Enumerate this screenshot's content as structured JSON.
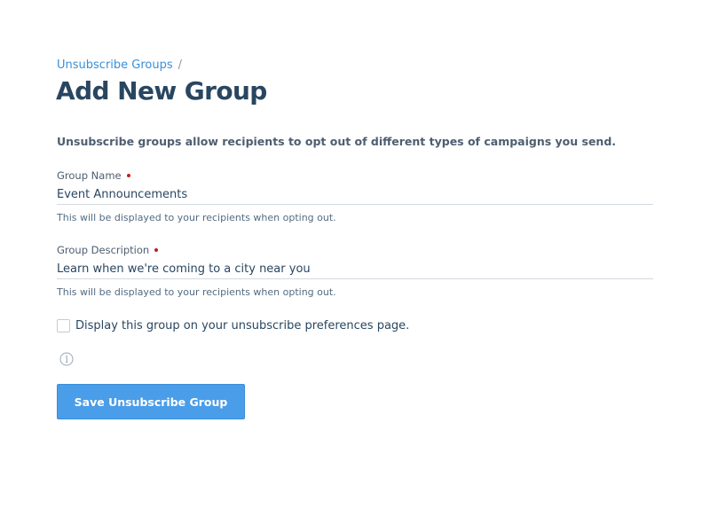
{
  "breadcrumb": {
    "link_label": "Unsubscribe Groups",
    "separator": "/"
  },
  "page": {
    "title": "Add New Group",
    "intro": "Unsubscribe groups allow recipients to opt out of different types of campaigns you send."
  },
  "form": {
    "group_name": {
      "label": "Group Name",
      "value": "Event Announcements",
      "help": "This will be displayed to your recipients when opting out.",
      "required": true
    },
    "group_description": {
      "label": "Group Description",
      "value": "Learn when we're coming to a city near you",
      "help": "This will be displayed to your recipients when opting out.",
      "required": true
    },
    "display_checkbox": {
      "label": "Display this group on your unsubscribe preferences page.",
      "checked": false
    },
    "info_icon": "info-icon",
    "save_label": "Save Unsubscribe Group"
  },
  "colors": {
    "accent": "#4a9de8",
    "link": "#3a8fd8",
    "title": "#294661",
    "required": "#c41f1f"
  }
}
